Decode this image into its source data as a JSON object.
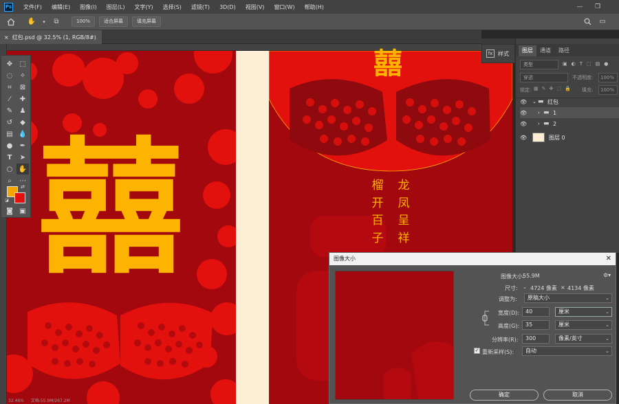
{
  "menu": {
    "logo": "Ps",
    "items": [
      "文件(F)",
      "编辑(E)",
      "图像(I)",
      "图层(L)",
      "文字(Y)",
      "选择(S)",
      "滤镜(T)",
      "3D(D)",
      "视图(V)",
      "窗口(W)",
      "帮助(H)"
    ]
  },
  "options": {
    "zoom": "100%",
    "fit_screen": "适合屏幕",
    "fill_screen": "填充屏幕"
  },
  "document": {
    "tab_title": "红包.psd @ 32.5% (1, RGB/8#)",
    "status_left": "32.46%",
    "status_doc": "文档:55.9M/267.2M"
  },
  "artwork": {
    "big_char": "囍",
    "small_char": "囍",
    "poem_columns": [
      [
        "榴",
        "开",
        "百",
        "子"
      ],
      [
        "龙",
        "凤",
        "呈",
        "祥"
      ]
    ],
    "colors": {
      "background": "#a3080e",
      "gold": "#fdb400",
      "cream": "#fcefd6",
      "bright_red": "#e3110d"
    }
  },
  "style_panel": {
    "label": "样式"
  },
  "layers_panel": {
    "tabs": [
      "图层",
      "通道",
      "路径"
    ],
    "kind_search": "类型",
    "blend_mode": "穿透",
    "opacity_label": "不透明度:",
    "opacity_value": "100%",
    "lock_label": "锁定:",
    "fill_label": "填充:",
    "fill_value": "100%",
    "layers": [
      {
        "name": "红包",
        "type": "group",
        "indent": 0
      },
      {
        "name": "1",
        "type": "group",
        "indent": 1,
        "selected": true
      },
      {
        "name": "2",
        "type": "group",
        "indent": 1
      },
      {
        "name": "图层 0",
        "type": "layer",
        "indent": 0
      }
    ]
  },
  "dialog": {
    "title": "图像大小",
    "image_size_label": "图像大小:",
    "image_size_value": "55.9M",
    "dimensions_label": "尺寸:",
    "dimensions_w": "4724 像素",
    "dimensions_x": "×",
    "dimensions_h": "4134 像素",
    "fit_label": "调整为:",
    "fit_value": "原稿大小",
    "width_label": "宽度(D):",
    "width_value": "40",
    "width_unit": "厘米",
    "height_label": "高度(G):",
    "height_value": "35",
    "height_unit": "厘米",
    "resolution_label": "分辨率(R):",
    "resolution_value": "300",
    "resolution_unit": "像素/英寸",
    "resample_label": "重新采样(S):",
    "resample_checked": true,
    "resample_value": "自动",
    "ok_label": "确定",
    "cancel_label": "取消"
  }
}
